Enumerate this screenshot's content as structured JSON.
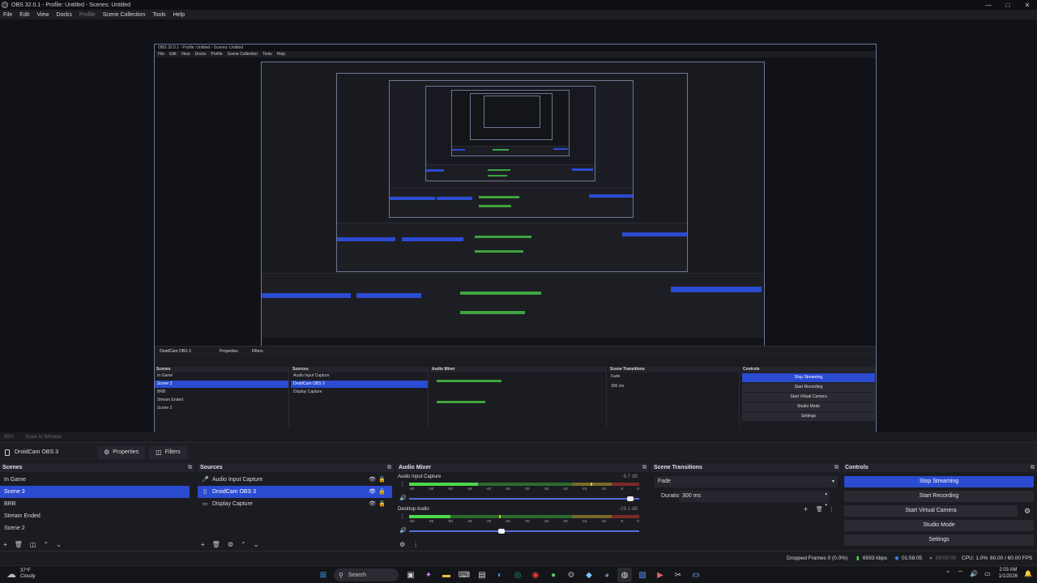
{
  "window": {
    "title": "OBS 32.0.1 - Profile: Untitled - Scenes: Untitled",
    "controls": {
      "min": "—",
      "max": "□",
      "close": "✕"
    }
  },
  "menu": {
    "items": [
      "File",
      "Edit",
      "View",
      "Docks",
      "Profile",
      "Scene Collection",
      "Tools",
      "Help"
    ]
  },
  "preview_bar": {
    "zoom": "69%",
    "scale_mode": "Scale to Window"
  },
  "source_toolbar": {
    "source_name": "DroidCam OBS 3",
    "properties_label": "Properties",
    "filters_label": "Filters"
  },
  "scenes": {
    "title": "Scenes",
    "items": [
      "In Game",
      "Scene 3",
      "BRB",
      "Stream Ended",
      "Scene 2"
    ],
    "selected_index": 1
  },
  "sources": {
    "title": "Sources",
    "items": [
      {
        "name": "Audio Input Capture",
        "icon": "microphone-icon"
      },
      {
        "name": "DroidCam OBS 3",
        "icon": "camera-icon"
      },
      {
        "name": "Display Capture",
        "icon": "monitor-icon"
      }
    ],
    "selected_index": 1
  },
  "audio_mixer": {
    "title": "Audio Mixer",
    "channels": [
      {
        "name": "Audio Input Capture",
        "db": "-6.7 dB",
        "level": 0.3,
        "peak": 0.79,
        "volume": 0.96
      },
      {
        "name": "Desktop Audio",
        "db": "-29.1 dB",
        "level": 0.18,
        "peak": 0.39,
        "volume": 0.4
      }
    ],
    "ticks": [
      "-60",
      "-55",
      "-50",
      "-45",
      "-40",
      "-35",
      "-30",
      "-25",
      "-20",
      "-15",
      "-10",
      "-5",
      "0"
    ]
  },
  "transitions": {
    "title": "Scene Transitions",
    "selected": "Fade",
    "duration_label": "Duration",
    "duration_value": "300 ms"
  },
  "controls": {
    "title": "Controls",
    "stop_streaming": "Stop Streaming",
    "start_recording": "Start Recording",
    "start_virtual_camera": "Start Virtual Camera",
    "studio_mode": "Studio Mode",
    "settings": "Settings"
  },
  "status": {
    "dropped_frames": "Dropped Frames 0 (0.0%)",
    "bitrate": "6593 kbps",
    "stream_time": "01:58:05",
    "rec_time": "00:00:00",
    "cpu": "CPU: 1.0%",
    "fps": "60.00 / 60.00 FPS"
  },
  "taskbar": {
    "weather_temp": "37°F",
    "weather_desc": "Cloudy",
    "search_label": "Search",
    "time": "2:03 AM",
    "date": "1/1/2026"
  },
  "nested": {
    "window_title": "OBS 32.0.1 - Profile: Untitled - Scenes: Untitled",
    "source_name": "DroidCam OBS 3",
    "properties": "Properties",
    "filters": "Filters"
  }
}
